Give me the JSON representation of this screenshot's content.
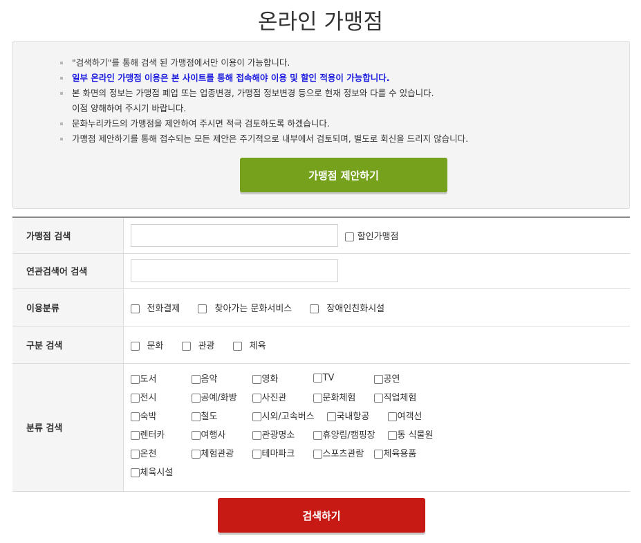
{
  "page": {
    "title": "온라인 가맹점"
  },
  "notice": {
    "items": [
      {
        "text": "\"검색하기\"를 통해 검색 된 가맹점에서만 이용이 가능합니다.",
        "strong": false
      },
      {
        "text": "일부 온라인 가맹점 이용은 본 사이트를 통해 접속해야 이용 및 할인 적용이 가능합니다.",
        "strong": true
      },
      {
        "text": "본 화면의 정보는 가맹점 폐업 또는 업종변경, 가맹점 정보변경 등으로 현재 정보와 다를 수 있습니다.",
        "cont": "이점 양해하여 주시기 바랍니다.",
        "strong": false
      },
      {
        "text": "문화누리카드의 가맹점을 제안하여 주시면 적극 검토하도록 하겠습니다.",
        "strong": false
      },
      {
        "text": "가맹점 제안하기를 통해 접수되는 모든 제안은 주기적으로 내부에서 검토되며, 별도로 회신을 드리지 않습니다.",
        "strong": false
      }
    ],
    "propose_button": "가맹점 제안하기"
  },
  "form": {
    "store_search": {
      "label": "가맹점 검색",
      "value": "",
      "discount_label": "할인가맹점"
    },
    "keyword_search": {
      "label": "연관검색어 검색",
      "value": ""
    },
    "usage": {
      "label": "이용분류",
      "options": [
        "전화결제",
        "찾아가는 문화서비스",
        "장애인친화시설"
      ]
    },
    "division": {
      "label": "구분 검색",
      "options": [
        "문화",
        "관광",
        "체육"
      ]
    },
    "category": {
      "label": "분류 검색",
      "rows": [
        [
          "도서",
          "음악",
          "영화",
          "TV",
          "공연"
        ],
        [
          "전시",
          "공예/화방",
          "사진관",
          "문화체험",
          "직업체험"
        ],
        [
          "숙박",
          "철도",
          "시외/고속버스",
          "국내항공",
          "여객선"
        ],
        [
          "렌터카",
          "여행사",
          "관광명소",
          "휴양림/캠핑장",
          "동 식물원"
        ],
        [
          "온천",
          "체험관광",
          "테마파크",
          "스포츠관람",
          "체육용품"
        ],
        [
          "체육시설"
        ]
      ]
    }
  },
  "search_button": "검색하기",
  "colors": {
    "propose": "#76a11d",
    "search": "#c81a14",
    "notice_strong": "#1a1adf"
  }
}
